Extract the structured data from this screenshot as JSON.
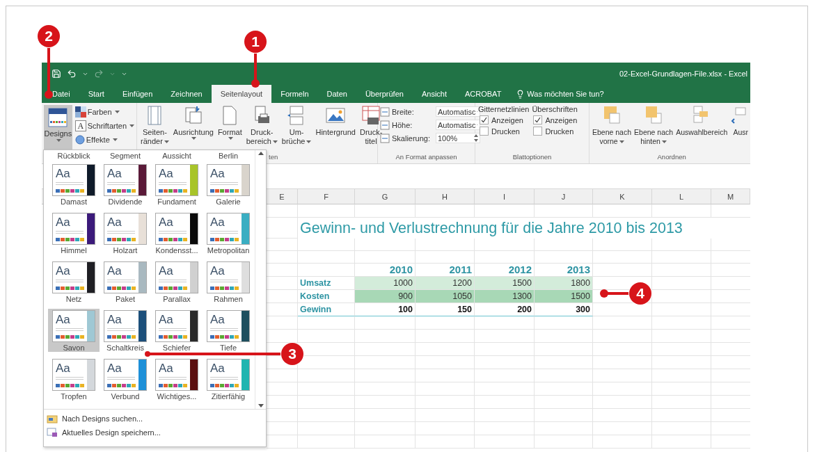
{
  "title_bar": {
    "file_title": "02-Excel-Grundlagen-File.xlsx - Excel"
  },
  "tabs": [
    {
      "label": "Datei",
      "selected": false
    },
    {
      "label": "Start",
      "selected": false
    },
    {
      "label": "Einfügen",
      "selected": false
    },
    {
      "label": "Zeichnen",
      "selected": false
    },
    {
      "label": "Seitenlayout",
      "selected": true
    },
    {
      "label": "Formeln",
      "selected": false
    },
    {
      "label": "Daten",
      "selected": false
    },
    {
      "label": "Überprüfen",
      "selected": false
    },
    {
      "label": "Ansicht",
      "selected": false
    },
    {
      "label": "ACROBAT",
      "selected": false
    }
  ],
  "tell_me": "Was möchten Sie tun?",
  "ribbon": {
    "designs": {
      "label": "Designs",
      "pressed": true,
      "options": [
        {
          "label": "Farben",
          "kind": "colors"
        },
        {
          "label": "Schriftarten",
          "kind": "fonts",
          "icon_letter": "A"
        },
        {
          "label": "Effekte",
          "kind": "effects"
        }
      ]
    },
    "page_setup": {
      "group_label": "ten",
      "buttons": [
        {
          "lines": [
            "Seiten-",
            "ränder"
          ],
          "kind": "margins",
          "dropdown": true
        },
        {
          "lines": [
            "Ausrichtung"
          ],
          "kind": "orientation",
          "dropdown": true
        },
        {
          "lines": [
            "Format"
          ],
          "kind": "size",
          "dropdown": true
        },
        {
          "lines": [
            "Druck-",
            "bereich"
          ],
          "kind": "print_area",
          "dropdown": true
        },
        {
          "lines": [
            "Um-",
            "brüche"
          ],
          "kind": "breaks",
          "dropdown": true
        },
        {
          "lines": [
            "Hintergrund"
          ],
          "kind": "background",
          "dropdown": false
        },
        {
          "lines": [
            "Druck-",
            "titel"
          ],
          "kind": "print_titles",
          "dropdown": false
        }
      ]
    },
    "scale": {
      "group_label": "An Format anpassen",
      "rows": [
        {
          "label": "Breite:",
          "value": "Automatisc",
          "kind": "select"
        },
        {
          "label": "Höhe:",
          "value": "Automatisc",
          "kind": "select"
        },
        {
          "label": "Skalierung:",
          "value": "100%",
          "kind": "spinner"
        }
      ]
    },
    "sheet_options": {
      "group_label": "Blattoptionen",
      "columns": [
        {
          "title": "Gitternetzlinien",
          "options": [
            {
              "label": "Anzeigen",
              "checked": true
            },
            {
              "label": "Drucken",
              "checked": false
            }
          ]
        },
        {
          "title": "Überschriften",
          "options": [
            {
              "label": "Anzeigen",
              "checked": true
            },
            {
              "label": "Drucken",
              "checked": false
            }
          ]
        }
      ]
    },
    "arrange": {
      "group_label": "Anordnen",
      "buttons": [
        {
          "lines": [
            "Ebene nach",
            "vorne"
          ],
          "kind": "forward",
          "dropdown": true
        },
        {
          "lines": [
            "Ebene nach",
            "hinten"
          ],
          "kind": "backward",
          "dropdown": true
        },
        {
          "lines": [
            "Auswahlbereich"
          ],
          "kind": "selection",
          "dropdown": false
        },
        {
          "lines": [
            "Ausr"
          ],
          "kind": "align",
          "dropdown": false
        }
      ]
    }
  },
  "gallery": {
    "previous_row": [
      "Rückblick",
      "Segment",
      "Aussicht",
      "Berlin"
    ],
    "themes": [
      {
        "name": "Damast",
        "sample": "Aa",
        "color": "#0f1b2a",
        "selected": false
      },
      {
        "name": "Dividende",
        "sample": "Aa",
        "color": "#5a1a38",
        "selected": false
      },
      {
        "name": "Fundament",
        "sample": "Aa",
        "color": "#a8c42a",
        "selected": false
      },
      {
        "name": "Galerie",
        "sample": "Aa",
        "color": "#d9d4cc",
        "selected": false
      },
      {
        "name": "Himmel",
        "sample": "Aa",
        "color": "#3b1a7a",
        "selected": false
      },
      {
        "name": "Holzart",
        "sample": "Aa",
        "color": "#e8e0d8",
        "selected": false
      },
      {
        "name": "Kondensst...",
        "sample": "Aa",
        "color": "#0a0a0a",
        "selected": false
      },
      {
        "name": "Metropolitan",
        "sample": "Aa",
        "color": "#3aaec2",
        "selected": false
      },
      {
        "name": "Netz",
        "sample": "Aa",
        "color": "#1f1f24",
        "selected": false
      },
      {
        "name": "Paket",
        "sample": "Aa",
        "color": "#a9b9c0",
        "selected": false
      },
      {
        "name": "Parallax",
        "sample": "Aa",
        "color": "#d0d0d0",
        "selected": false
      },
      {
        "name": "Rahmen",
        "sample": "Aa",
        "color": "#dedede",
        "selected": false
      },
      {
        "name": "Savon",
        "sample": "Aa",
        "color": "#9fc8d4",
        "selected": true
      },
      {
        "name": "Schaltkreis",
        "sample": "Aa",
        "color": "#1c4f7a",
        "selected": false
      },
      {
        "name": "Schiefer",
        "sample": "Aa",
        "color": "#2a2a2a",
        "selected": false
      },
      {
        "name": "Tiefe",
        "sample": "Aa",
        "color": "#1e4f5e",
        "selected": false
      },
      {
        "name": "Tropfen",
        "sample": "Aa",
        "color": "#d4d8dc",
        "selected": false
      },
      {
        "name": "Verbund",
        "sample": "Aa",
        "color": "#1e90d8",
        "selected": false
      },
      {
        "name": "Wichtiges...",
        "sample": "Aa",
        "color": "#5a1010",
        "selected": false
      },
      {
        "name": "Zitierfähig",
        "sample": "Aa",
        "color": "#20b5b0",
        "selected": false
      }
    ],
    "actions": [
      {
        "label": "Nach Designs suchen...",
        "kind": "browse"
      },
      {
        "label": "Aktuelles Design speichern...",
        "kind": "save"
      }
    ]
  },
  "sheet": {
    "columns": [
      "E",
      "F",
      "G",
      "H",
      "I",
      "J",
      "K",
      "L",
      "M"
    ],
    "title": "Gewinn- und Verlustrechnung für die Jahre 2010 bis 2013",
    "years": [
      "2010",
      "2011",
      "2012",
      "2013"
    ],
    "rows": [
      {
        "label": "Umsatz",
        "kind": "light",
        "values": [
          "1000",
          "1200",
          "1500",
          "1800"
        ]
      },
      {
        "label": "Kosten",
        "kind": "dark",
        "values": [
          "900",
          "1050",
          "1300",
          "1500"
        ]
      },
      {
        "label": "Gewinn",
        "kind": "total",
        "values": [
          "100",
          "150",
          "200",
          "300"
        ]
      }
    ]
  },
  "callouts": [
    "1",
    "2",
    "3",
    "4"
  ]
}
